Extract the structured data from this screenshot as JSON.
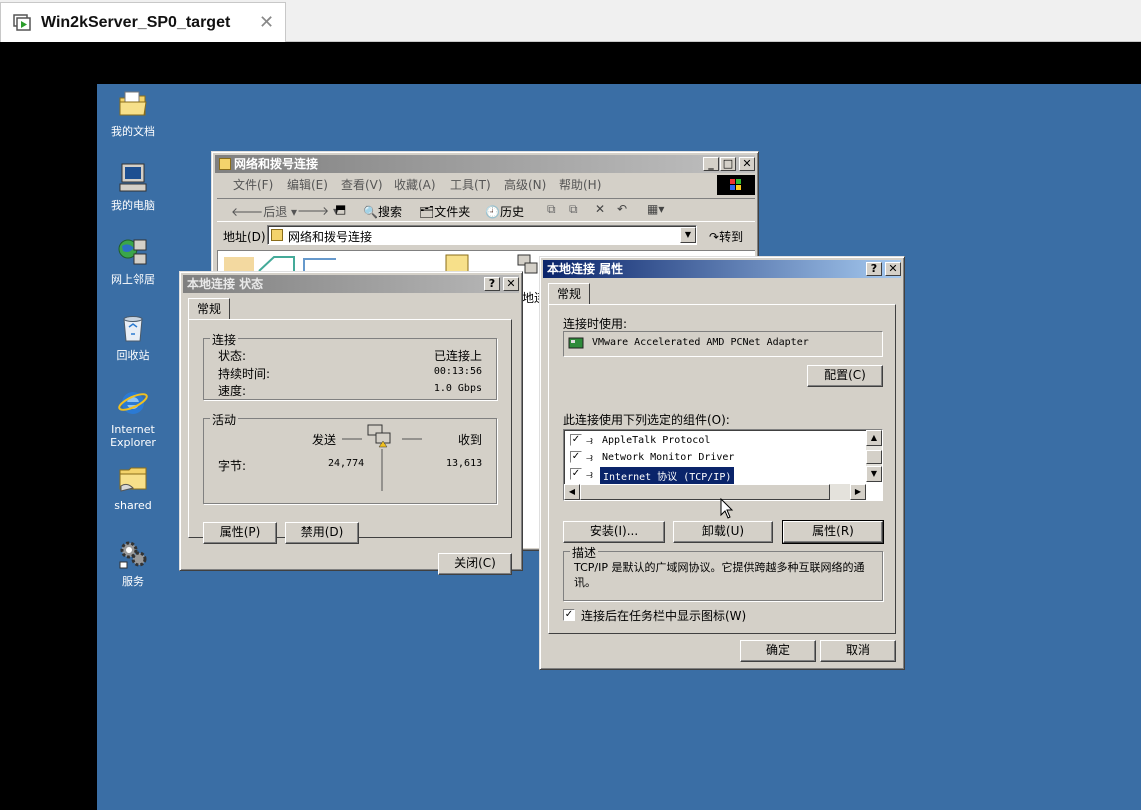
{
  "host": {
    "tab_title": "Win2kServer_SP0_target",
    "close_glyph": "✕"
  },
  "desktop_icons": [
    {
      "label": "我的文档",
      "icon": "my-documents-icon"
    },
    {
      "label": "我的电脑",
      "icon": "my-computer-icon"
    },
    {
      "label": "网上邻居",
      "icon": "network-places-icon"
    },
    {
      "label": "回收站",
      "icon": "recycle-bin-icon"
    },
    {
      "label": "Internet Explorer",
      "icon": "ie-icon"
    },
    {
      "label": "shared",
      "icon": "folder-icon"
    },
    {
      "label": "服务",
      "icon": "services-icon"
    }
  ],
  "explorer": {
    "title": "网络和拨号连接",
    "menu": [
      "文件(F)",
      "编辑(E)",
      "查看(V)",
      "收藏(A)",
      "工具(T)",
      "高级(N)",
      "帮助(H)"
    ],
    "toolbar": {
      "back": "后退",
      "search": "搜索",
      "folders": "文件夹",
      "history": "历史"
    },
    "address_label": "地址(D)",
    "address_value": "网络和拨号连接",
    "go_label": "转到",
    "partial_item": "地连"
  },
  "status_dialog": {
    "title": "本地连接 状态",
    "tab": "常规",
    "connection_group": "连接",
    "status_label": "状态:",
    "status_value": "已连接上",
    "duration_label": "持续时间:",
    "duration_value": "00:13:56",
    "speed_label": "速度:",
    "speed_value": "1.0 Gbps",
    "activity_group": "活动",
    "sent_label": "发送",
    "received_label": "收到",
    "bytes_label": "字节:",
    "bytes_sent": "24,774",
    "bytes_received": "13,613",
    "properties_button": "属性(P)",
    "disable_button": "禁用(D)",
    "close_button": "关闭(C)"
  },
  "props_dialog": {
    "title": "本地连接 属性",
    "tab": "常规",
    "connect_using_label": "连接时使用:",
    "adapter": "VMware Accelerated AMD PCNet Adapter",
    "configure_button": "配置(C)",
    "components_label": "此连接使用下列选定的组件(O):",
    "components": [
      {
        "name": "AppleTalk Protocol",
        "checked": true,
        "selected": false
      },
      {
        "name": "Network Monitor Driver",
        "checked": true,
        "selected": false
      },
      {
        "name": "Internet 协议 (TCP/IP)",
        "checked": true,
        "selected": true
      }
    ],
    "install_button": "安装(I)...",
    "uninstall_button": "卸载(U)",
    "properties_button": "属性(R)",
    "description_group": "描述",
    "description_text": "TCP/IP 是默认的广域网协议。它提供跨越多种互联网络的通讯。",
    "show_icon_label": "连接后在任务栏中显示图标(W)",
    "show_icon_checked": true,
    "ok_button": "确定",
    "cancel_button": "取消"
  },
  "colors": {
    "desktop": "#3a6ea5",
    "active_title": "#0a246a",
    "selection": "#0a246a"
  }
}
